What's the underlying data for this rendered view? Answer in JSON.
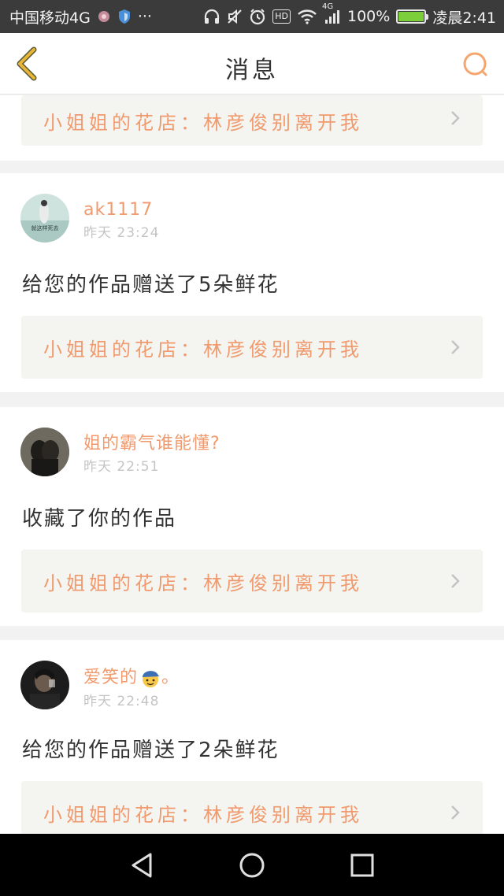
{
  "status_bar": {
    "carrier": "中国移动4G",
    "network_badge": "4G",
    "battery_text": "100%",
    "battery_level": 1.0,
    "time": "凌晨2:41",
    "icons": [
      "app-notification-icon",
      "shield-icon",
      "more-dots-icon",
      "headphones-icon",
      "mute-icon",
      "alarm-icon",
      "hd-icon",
      "wifi-icon",
      "signal-icon",
      "battery-icon"
    ],
    "more_dots": "···",
    "hd_label": "HD"
  },
  "header": {
    "title": "消息",
    "back_icon": "chevron-left-icon",
    "search_icon": "search-icon"
  },
  "colors": {
    "accent": "#f09a6e",
    "back_icon": "#e8b637",
    "search_icon": "#f5a66f",
    "status_bar": "#3b3b3b",
    "link_box": "#f4f4f0"
  },
  "top_partial_card": {
    "link_text": "小姐姐的花店：林彦俊别离开我"
  },
  "messages": [
    {
      "username": "ak1117",
      "time": "昨天 23:24",
      "text": "给您的作品赠送了5朵鲜花",
      "link_text": "小姐姐的花店：林彦俊别离开我",
      "avatar_caption": "就这样死去"
    },
    {
      "username": "姐的霸气谁能懂?",
      "time": "昨天 22:51",
      "text": "收藏了你的作品",
      "link_text": "小姐姐的花店：林彦俊别离开我"
    },
    {
      "username": "爱笑的",
      "username_suffix": "。",
      "time": "昨天 22:48",
      "text": "给您的作品赠送了2朵鲜花",
      "link_text": "小姐姐的花店：林彦俊别离开我"
    }
  ],
  "nav_bar": {
    "back": "triangle-back-icon",
    "home": "circle-home-icon",
    "recents": "square-recents-icon"
  }
}
